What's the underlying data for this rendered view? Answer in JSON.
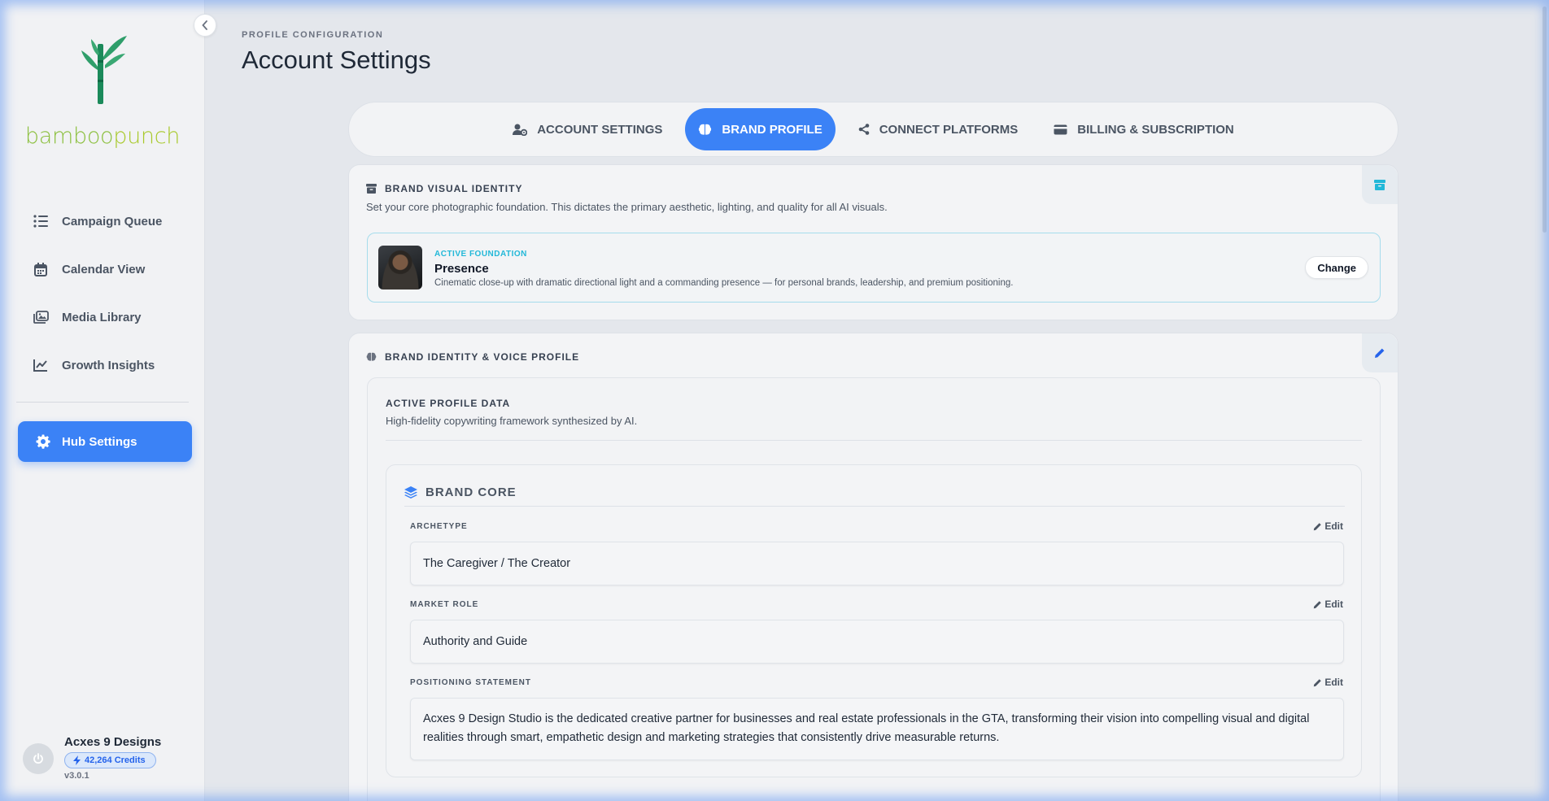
{
  "sidebar": {
    "logo_text_a": "bamboo",
    "logo_text_b": "punch",
    "items": [
      {
        "label": "Campaign Queue",
        "icon": "list-icon"
      },
      {
        "label": "Calendar View",
        "icon": "calendar-icon"
      },
      {
        "label": "Media Library",
        "icon": "images-icon"
      },
      {
        "label": "Growth Insights",
        "icon": "chart-line-icon"
      }
    ],
    "active_item": {
      "label": "Hub Settings",
      "icon": "gear-icon"
    },
    "user": {
      "name": "Acxes 9 Designs",
      "credits": "42,264 Credits",
      "version": "v3.0.1"
    }
  },
  "header": {
    "eyebrow": "PROFILE CONFIGURATION",
    "title": "Account Settings"
  },
  "tabs": [
    {
      "label": "ACCOUNT SETTINGS",
      "icon": "user-gear-icon",
      "active": false
    },
    {
      "label": "BRAND PROFILE",
      "icon": "brain-icon",
      "active": true
    },
    {
      "label": "CONNECT PLATFORMS",
      "icon": "share-nodes-icon",
      "active": false
    },
    {
      "label": "BILLING & SUBSCRIPTION",
      "icon": "credit-card-icon",
      "active": false
    }
  ],
  "visual_identity": {
    "title": "BRAND VISUAL IDENTITY",
    "subtitle": "Set your core photographic foundation. This dictates the primary aesthetic, lighting, and quality for all AI visuals.",
    "foundation": {
      "eyebrow": "ACTIVE FOUNDATION",
      "name": "Presence",
      "description": "Cinematic close-up with dramatic directional light and a commanding presence — for personal brands, leadership, and premium positioning.",
      "change_label": "Change"
    }
  },
  "voice_profile": {
    "title": "BRAND IDENTITY & VOICE PROFILE",
    "panel_title": "ACTIVE PROFILE DATA",
    "panel_subtitle": "High-fidelity copywriting framework synthesized by AI.",
    "core": {
      "title": "BRAND CORE",
      "fields": [
        {
          "label": "ARCHETYPE",
          "value": "The Caregiver / The Creator",
          "edit": "Edit"
        },
        {
          "label": "MARKET ROLE",
          "value": "Authority and Guide",
          "edit": "Edit"
        },
        {
          "label": "POSITIONING STATEMENT",
          "value": "Acxes 9 Design Studio is the dedicated creative partner for businesses and real estate professionals in the GTA, transforming their vision into compelling visual and digital realities through smart, empathetic design and marketing strategies that consistently drive measurable returns.",
          "edit": "Edit"
        }
      ]
    }
  },
  "colors": {
    "accent": "#3b82f6",
    "teal": "#22b8d8",
    "logo_green": "#8bbf3d"
  }
}
